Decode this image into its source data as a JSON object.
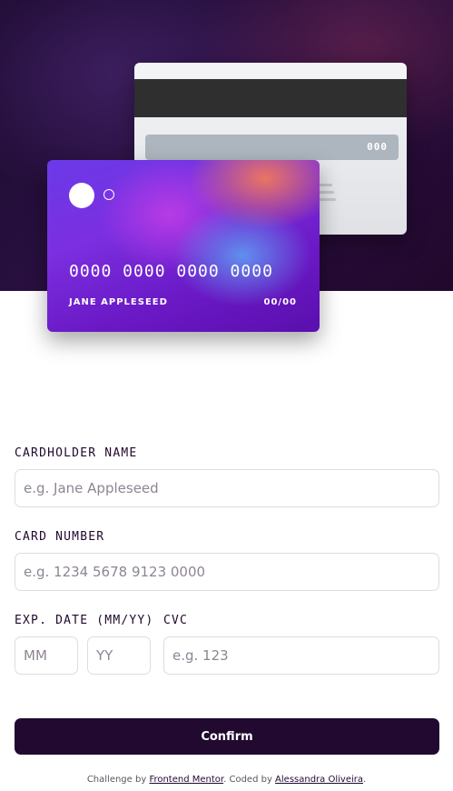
{
  "card_back": {
    "cvc": "000"
  },
  "card_front": {
    "number": "0000 0000 0000 0000",
    "name": "JANE APPLESEED",
    "expiry": "00/00"
  },
  "form": {
    "cardholder": {
      "label": "CARDHOLDER NAME",
      "placeholder": "e.g. Jane Appleseed"
    },
    "number": {
      "label": "CARD NUMBER",
      "placeholder": "e.g. 1234 5678 9123 0000"
    },
    "exp": {
      "label": "EXP. DATE (MM/YY)",
      "mm_placeholder": "MM",
      "yy_placeholder": "YY"
    },
    "cvc": {
      "label": "CVC",
      "placeholder": "e.g. 123"
    },
    "confirm_label": "Confirm"
  },
  "footer": {
    "prefix": "Challenge by ",
    "link1": "Frontend Mentor",
    "middle": ". Coded by ",
    "link2": "Alessandra Oliveira",
    "suffix": "."
  },
  "colors": {
    "dark_violet": "#21092f",
    "input_border": "#dedddf",
    "placeholder": "#8e8593"
  }
}
